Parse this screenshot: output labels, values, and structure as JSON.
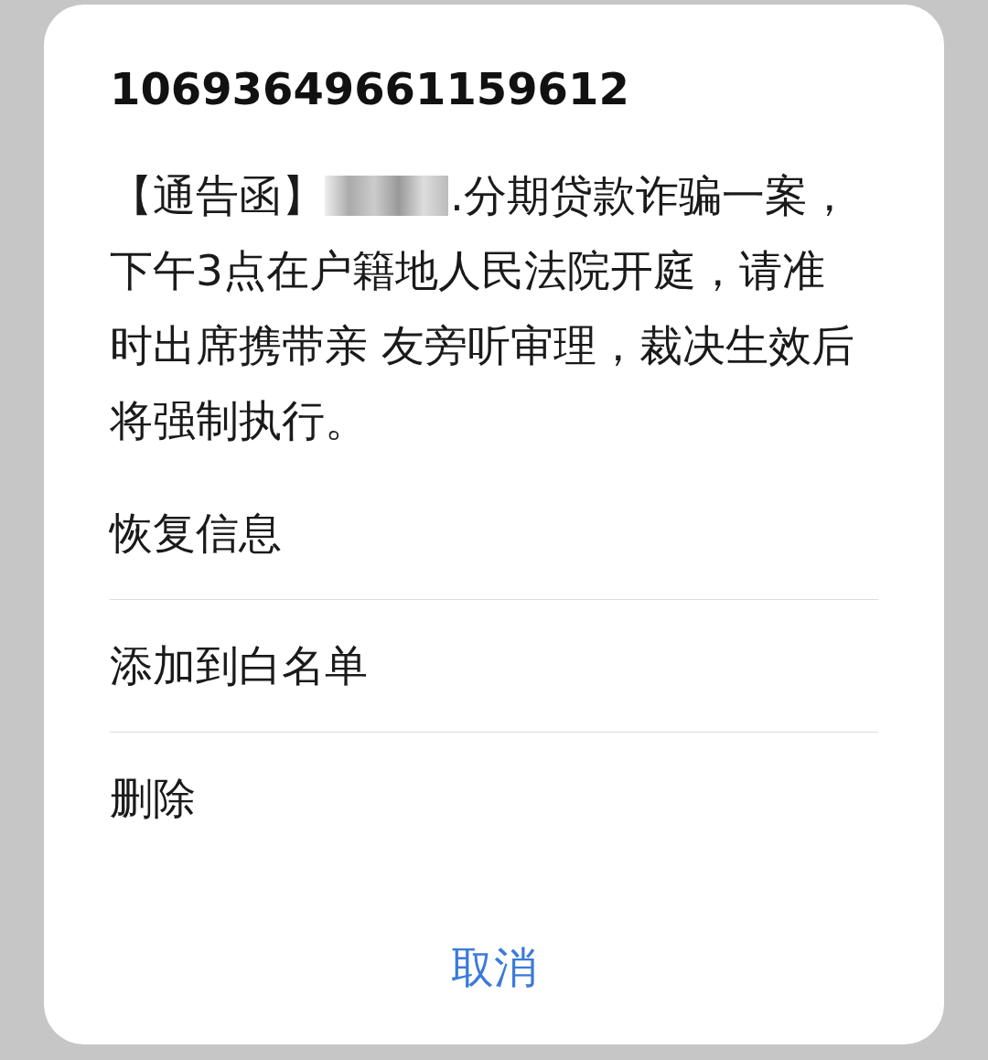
{
  "dialog": {
    "title": "10693649661159612",
    "message": {
      "prefix": "【通告函】",
      "redacted": true,
      "first_line_rest": ".分期贷款诈骗一案，",
      "lines": [
        "下午3点在户籍地人民法院开庭，请准",
        "时出席携带亲 友旁听审理，裁决生效后",
        "将强制执行。"
      ]
    },
    "actions": [
      "恢复信息",
      "添加到白名单",
      "删除"
    ],
    "cancel": "取消"
  }
}
